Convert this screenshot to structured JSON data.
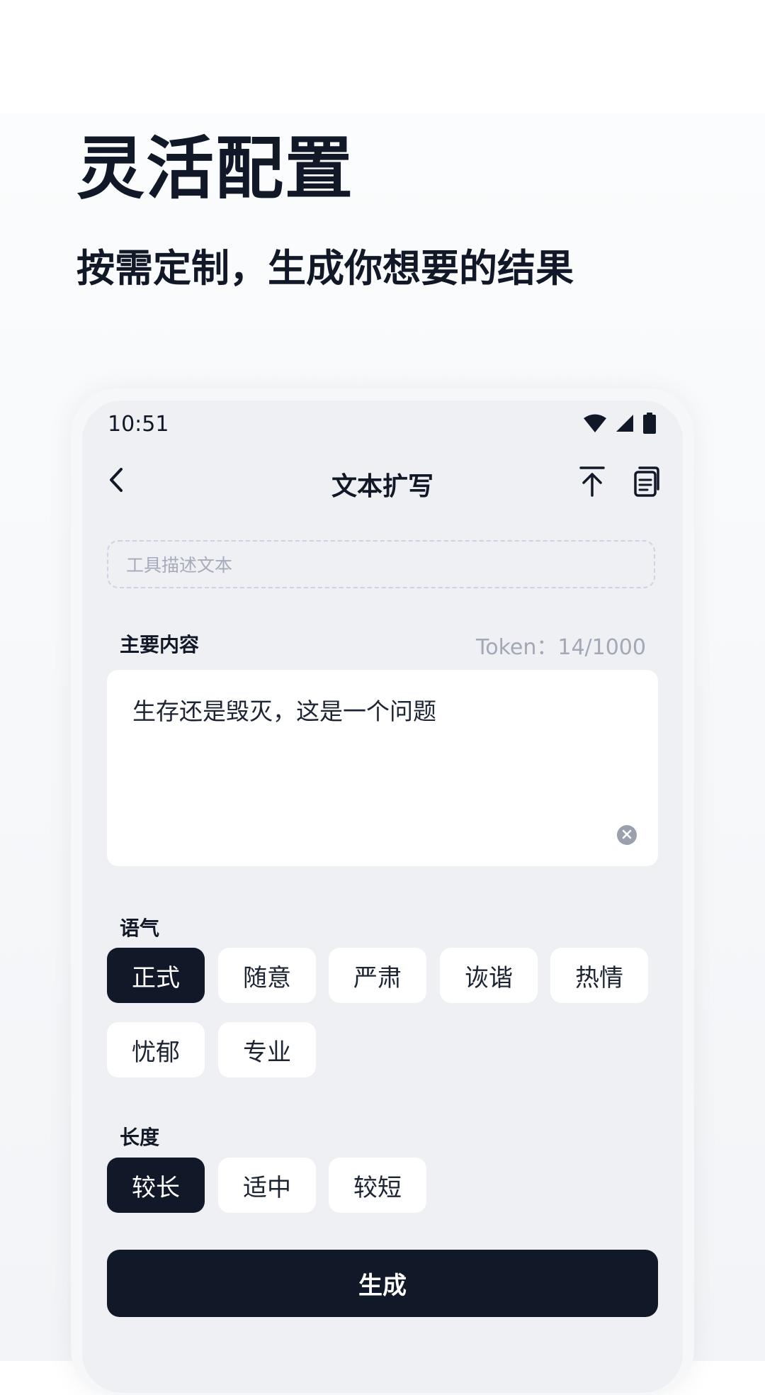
{
  "hero": {
    "title": "灵活配置",
    "subtitle": "按需定制，生成你想要的结果"
  },
  "status_bar": {
    "time": "10:51",
    "icons": [
      "wifi-icon",
      "cellular-signal-icon",
      "battery-icon"
    ]
  },
  "nav": {
    "title": "文本扩写",
    "back_icon": "chevron-left-icon",
    "actions": [
      "share-upload-icon",
      "copy-document-icon"
    ]
  },
  "description": {
    "placeholder": "工具描述文本"
  },
  "main_content": {
    "label": "主要内容",
    "token_count": "Token：14/1000",
    "value": "生存还是毁灭，这是一个问题"
  },
  "tone": {
    "label": "语气",
    "options": [
      "正式",
      "随意",
      "严肃",
      "诙谐",
      "热情",
      "忧郁",
      "专业"
    ],
    "selected": "正式"
  },
  "length": {
    "label": "长度",
    "options": [
      "较长",
      "适中",
      "较短"
    ],
    "selected": "较长"
  },
  "generate_button": {
    "label": "生成"
  },
  "colors": {
    "primary_dark": "#111827",
    "phone_bg": "#eff0f4",
    "chip_bg": "#ffffff",
    "muted_text": "#a3a8b7"
  }
}
